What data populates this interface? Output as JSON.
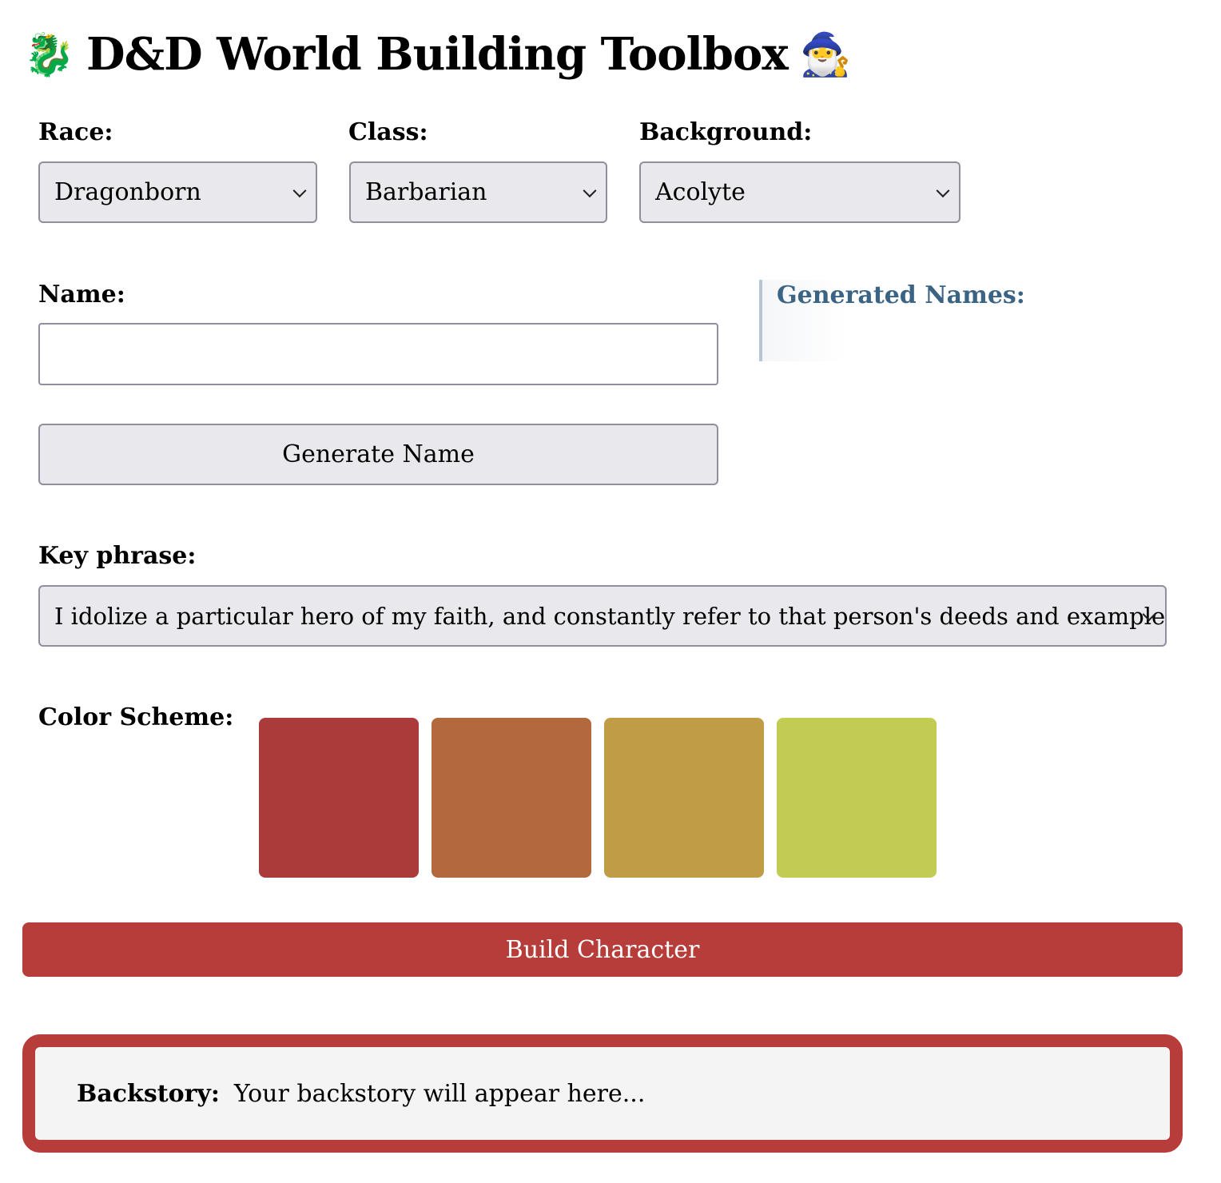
{
  "header": {
    "title": "D&D World Building Toolbox",
    "left_emoji": "🐉",
    "right_emoji": "🧙‍♂️"
  },
  "race": {
    "label": "Race:",
    "selected": "Dragonborn"
  },
  "class": {
    "label": "Class:",
    "selected": "Barbarian"
  },
  "background": {
    "label": "Background:",
    "selected": "Acolyte"
  },
  "name": {
    "label": "Name:",
    "value": "",
    "generate_button": "Generate Name"
  },
  "generated_names": {
    "title": "Generated Names:"
  },
  "key_phrase": {
    "label": "Key phrase:",
    "selected": "I idolize a particular hero of my faith, and constantly refer to that person's deeds and example."
  },
  "color_scheme": {
    "label": "Color Scheme:",
    "swatches": [
      "#ab3b3a",
      "#b3693d",
      "#c09c45",
      "#c0cc52"
    ]
  },
  "build_button": "Build Character",
  "backstory": {
    "label": "Backstory:",
    "text": "Your backstory will appear here..."
  },
  "colors": {
    "accent": "#b73d3b",
    "generated_names_title": "#3a6384"
  }
}
